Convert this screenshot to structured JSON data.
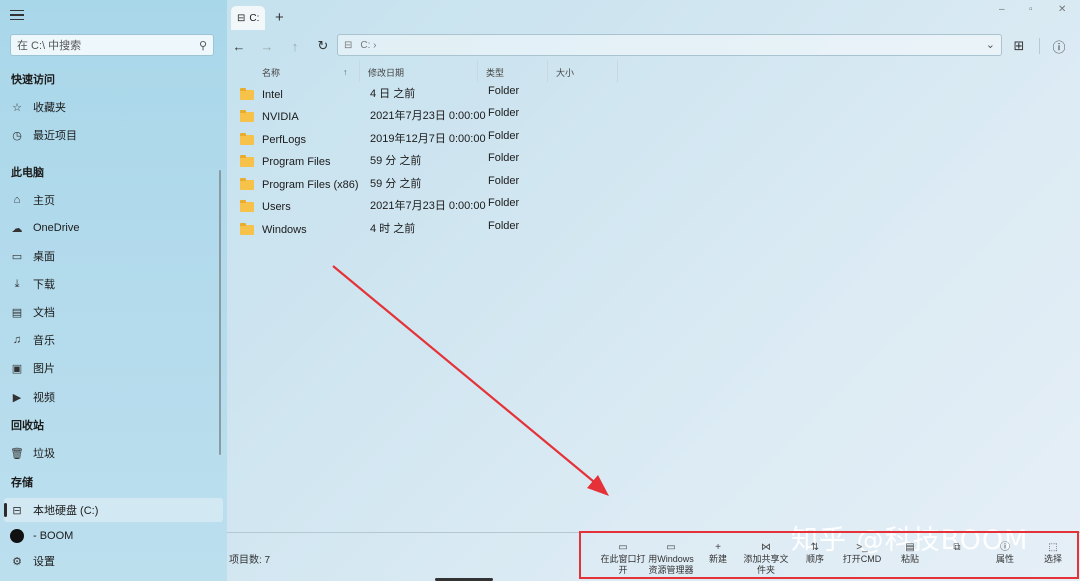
{
  "sidebar": {
    "search_placeholder": "在 C:\\ 中搜索",
    "quick_access": "快速访问",
    "favorites": "收藏夹",
    "recent": "最近项目",
    "this_pc": "此电脑",
    "home": "主页",
    "onedrive": "OneDrive",
    "desktop": "桌面",
    "downloads": "下载",
    "documents": "文档",
    "music": "音乐",
    "pictures": "图片",
    "videos": "视频",
    "recycle_bin_head": "回收站",
    "trash": "垃圾",
    "storage": "存储",
    "local_disk": "本地硬盘 (C:)",
    "boom": "- BOOM",
    "settings": "设置"
  },
  "tab": {
    "label": "C:"
  },
  "address": {
    "path": "C: ›"
  },
  "columns": {
    "name": "名称",
    "modified": "修改日期",
    "type": "类型",
    "size": "大小"
  },
  "files": [
    {
      "name": "Intel",
      "date": "4 日 之前",
      "type": "Folder"
    },
    {
      "name": "NVIDIA",
      "date": "2021年7月23日 0:00:00",
      "type": "Folder"
    },
    {
      "name": "PerfLogs",
      "date": "2019年12月7日 0:00:00",
      "type": "Folder"
    },
    {
      "name": "Program Files",
      "date": "59 分 之前",
      "type": "Folder"
    },
    {
      "name": "Program Files (x86)",
      "date": "59 分 之前",
      "type": "Folder"
    },
    {
      "name": "Users",
      "date": "2021年7月23日 0:00:00",
      "type": "Folder"
    },
    {
      "name": "Windows",
      "date": "4 时 之前",
      "type": "Folder"
    }
  ],
  "status": {
    "count": "项目数: 7"
  },
  "commands": {
    "open_here_1": "在此窗口打",
    "open_here_2": "开",
    "open_explorer_1": "用Windows",
    "open_explorer_2": "资源管理器",
    "new": "新建",
    "share_1": "添加共享文",
    "share_2": "件夹",
    "sort": "顺序",
    "cmd": "打开CMD",
    "paste": "粘贴",
    "properties": "属性",
    "select": "选择"
  },
  "watermark": "知乎 @科技BOOM",
  "colors": {
    "highlight_box": "#e53238",
    "arrow": "#e53238",
    "folder": "#f6c24a"
  }
}
